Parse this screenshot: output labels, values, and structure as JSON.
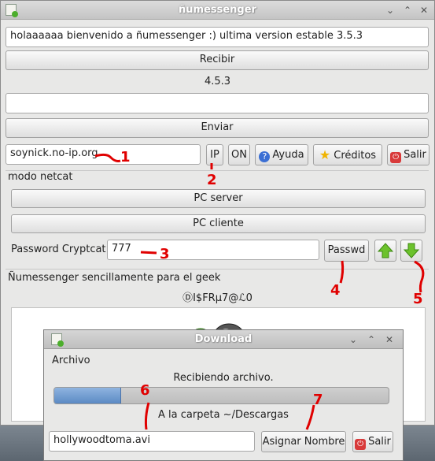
{
  "main_window": {
    "title": "ñumessenger",
    "message_text": "holaaaaaa bienvenido a ñumessenger :) ultima version estable 3.5.3",
    "receive_label": "Recibir",
    "version": "4.5.3",
    "send_text": "",
    "send_label": "Enviar",
    "host_value": "soynick.no-ip.org",
    "ip_label": "IP",
    "on_label": "ON",
    "help_label": "Ayuda",
    "credits_label": "Créditos",
    "exit_label": "Salir",
    "netcat_section": "modo netcat",
    "pc_server_label": "PC server",
    "pc_client_label": "PC cliente",
    "password_label": "Password Cryptcat",
    "password_value": "777",
    "passwd_button": "Passwd",
    "tagline": "Ñumessenger sencillamente para el geek",
    "stylized_text": "ⒹⅠ$FRμ7@ℒ0"
  },
  "annotations": [
    "1",
    "2",
    "3",
    "4",
    "5",
    "6",
    "7"
  ],
  "dialog": {
    "title": "Download",
    "section": "Archivo",
    "status": "Recibiendo archivo.",
    "progress": 0.2,
    "destination": "A la carpeta ~/Descargas",
    "filename_value": "hollywoodtoma.avi",
    "assign_name_label": "Asignar Nombre",
    "exit_label": "Salir"
  },
  "colors": {
    "annotation": "#e00000",
    "progress": "#5b8ac4"
  }
}
